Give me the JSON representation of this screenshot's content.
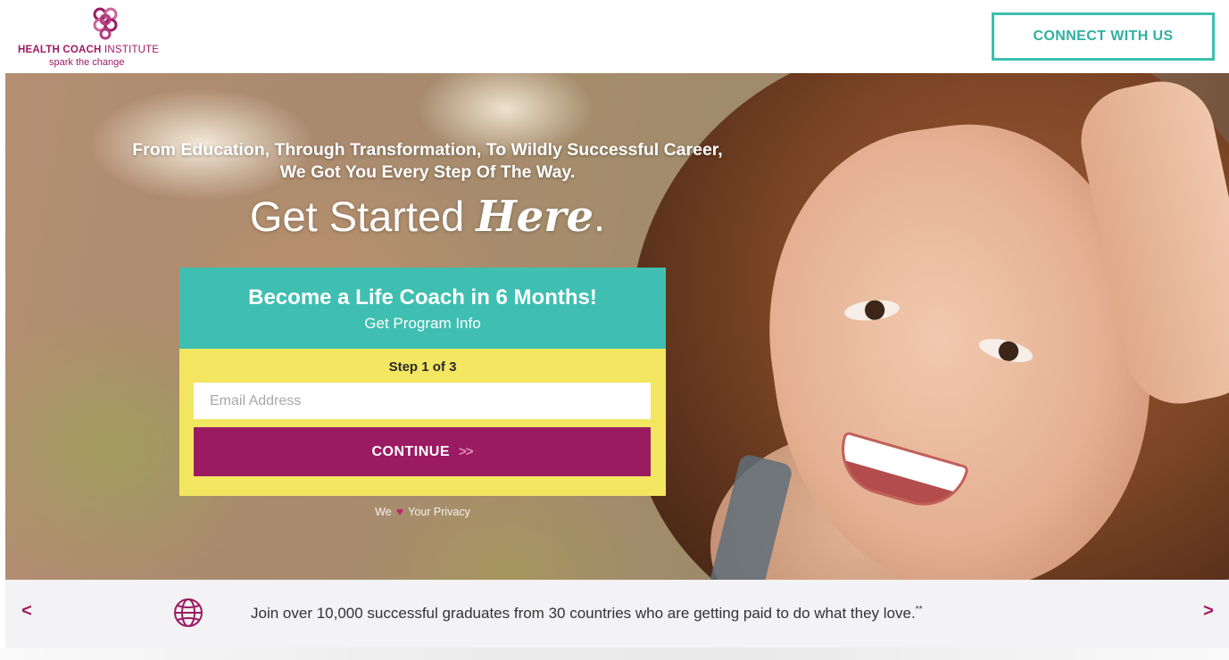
{
  "header": {
    "logo": {
      "name_bold": "HEALTH COACH",
      "name_light": "INSTITUTE",
      "tagline": "spark the change",
      "icon": "knot-logo-icon"
    },
    "connect_label": "CONNECT WITH US"
  },
  "hero": {
    "tagline_line1": "From Education, Through Transformation, To Wildly Successful Career,",
    "tagline_line2": "We Got You Every Step Of The Way.",
    "headline_prefix": "Get Started ",
    "headline_script": "Here",
    "headline_suffix": "."
  },
  "form": {
    "title": "Become a Life Coach in 6 Months!",
    "subtitle": "Get Program Info",
    "step": "Step 1 of 3",
    "email_placeholder": "Email Address",
    "email_value": "",
    "continue_label": "CONTINUE",
    "continue_chevrons": ">>",
    "privacy_before": "We",
    "privacy_icon": "heart-icon",
    "privacy_after": "Your Privacy"
  },
  "strip": {
    "prev_label": "<",
    "next_label": ">",
    "icon": "globe-icon",
    "text": "Join over 10,000 successful graduates from 30 countries who are getting paid to do what they love.",
    "footnote": "**"
  },
  "colors": {
    "brand_magenta": "#9b1b63",
    "teal": "#3fbfb1",
    "yellow": "#f3e661"
  }
}
